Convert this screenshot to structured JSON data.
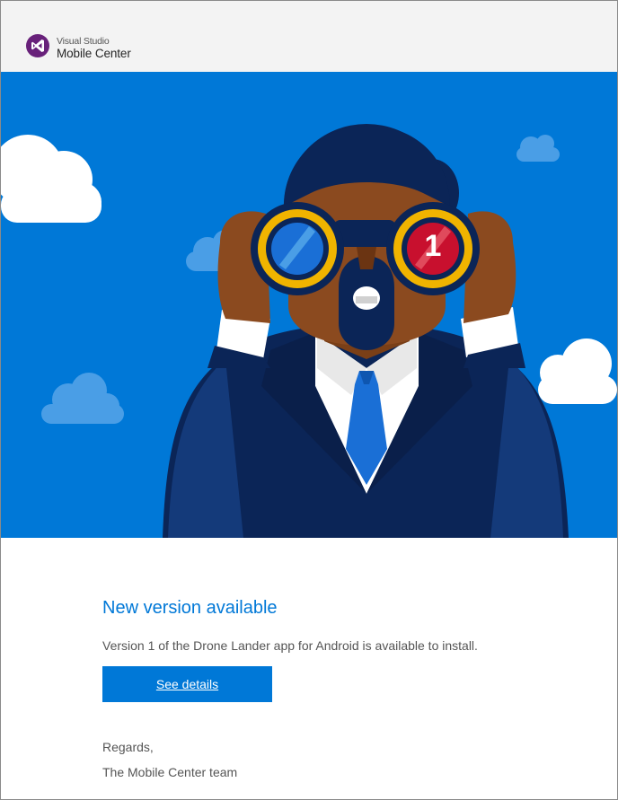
{
  "header": {
    "brand_line1": "Visual Studio",
    "brand_line2": "Mobile Center",
    "logo_icon": "visual-studio-logo"
  },
  "hero": {
    "illustration": "person-with-binoculars",
    "badge_number": "1",
    "background_color": "#0078d7"
  },
  "main": {
    "title": "New version available",
    "description": "Version 1 of the Drone Lander app for Android is available to install.",
    "button_label": "See details",
    "regards": "Regards,",
    "signature": "The Mobile Center team"
  },
  "colors": {
    "accent": "#0078d7",
    "text": "#555555",
    "header_bg": "#f3f3f3"
  }
}
